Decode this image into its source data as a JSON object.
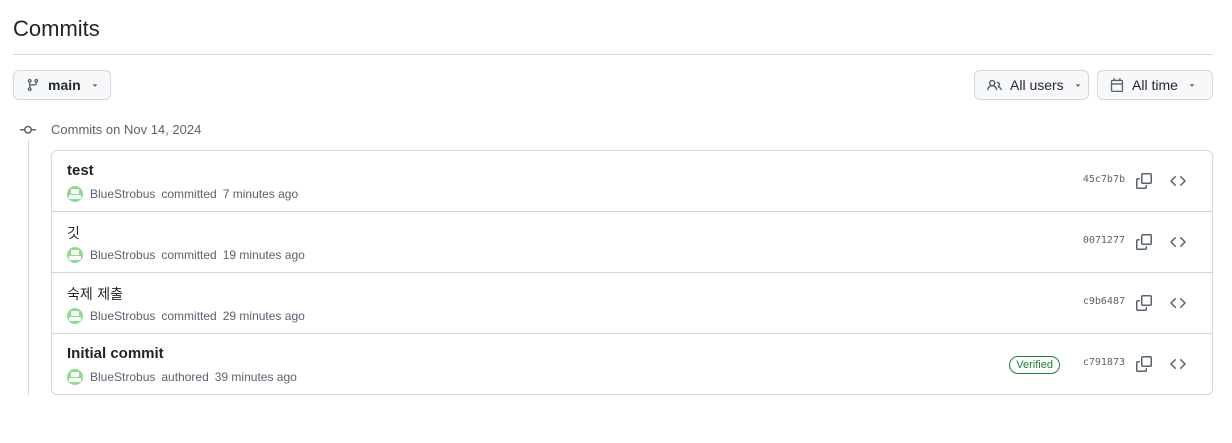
{
  "header": {
    "title": "Commits"
  },
  "filters": {
    "branch_label": "main",
    "users_label": "All users",
    "time_label": "All time"
  },
  "group": {
    "label": "Commits on Nov 14, 2024"
  },
  "commits": [
    {
      "title": "test",
      "author": "BlueStrobus",
      "action": "committed",
      "time": "7 minutes ago",
      "sha": "45c7b7b",
      "verified": false
    },
    {
      "title": "깃",
      "author": "BlueStrobus",
      "action": "committed",
      "time": "19 minutes ago",
      "sha": "0071277",
      "verified": false
    },
    {
      "title": "숙제 제출",
      "author": "BlueStrobus",
      "action": "committed",
      "time": "29 minutes ago",
      "sha": "c9b6487",
      "verified": false
    },
    {
      "title": "Initial commit",
      "author": "BlueStrobus",
      "action": "authored",
      "time": "39 minutes ago",
      "sha": "c791873",
      "verified": true,
      "verified_label": "Verified"
    }
  ],
  "colors": {
    "verified": "#1a7f37",
    "border": "#d1d9e0",
    "muted": "#59636e"
  }
}
